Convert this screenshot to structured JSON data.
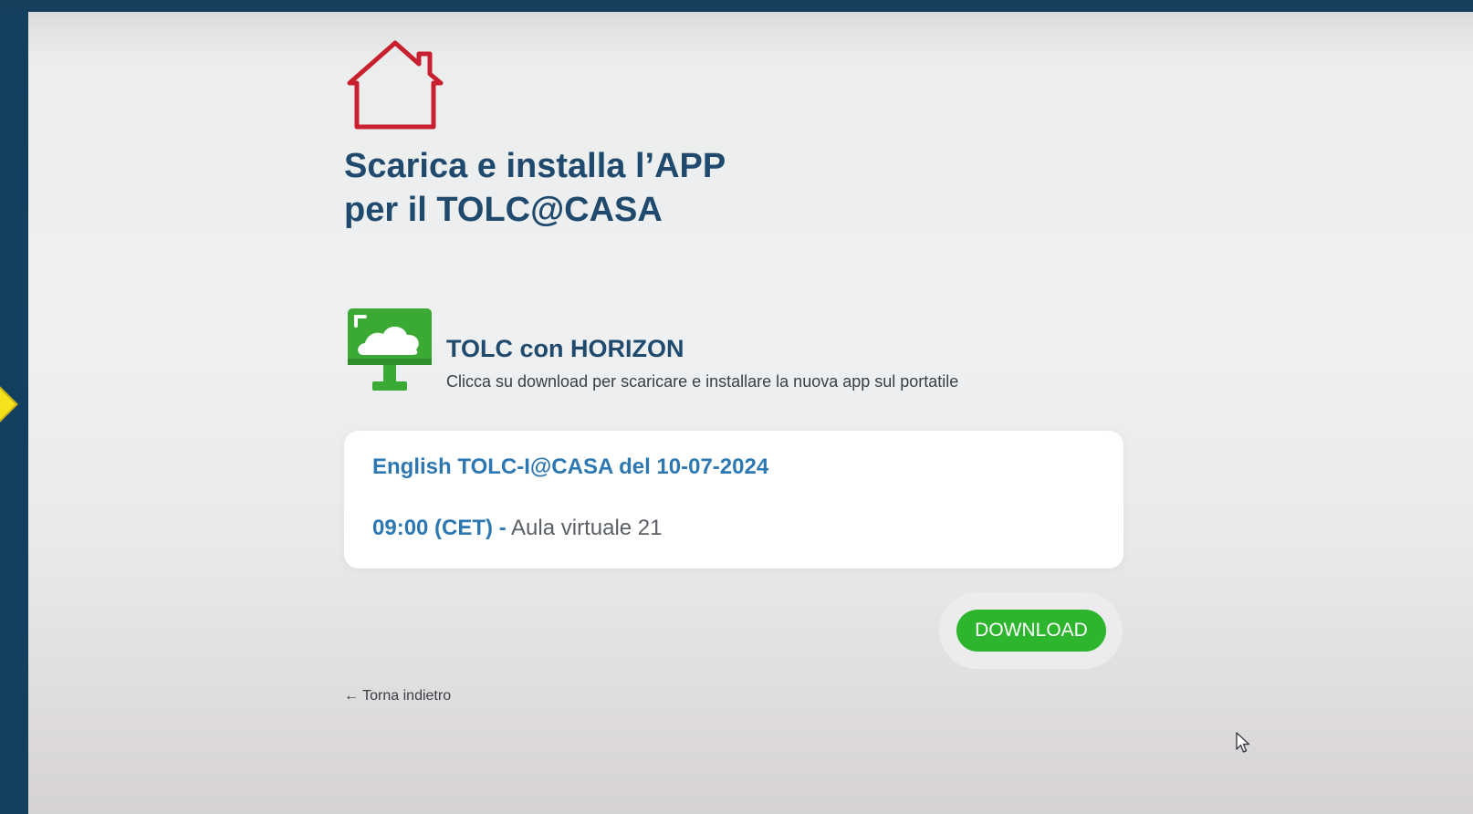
{
  "page": {
    "title_line1": "Scarica e installa l’APP",
    "title_line2": "per il TOLC@CASA"
  },
  "app": {
    "name": "TOLC con HORIZON",
    "description": "Clicca su download per scaricare e installare la nuova app sul portatile",
    "icon": "monitor-cloud-icon"
  },
  "session": {
    "title": "English TOLC-I@CASA del 10-07-2024",
    "time": "09:00 (CET) -",
    "room": "Aula virtuale 21"
  },
  "actions": {
    "download_label": "DOWNLOAD",
    "back_label": "Torna indietro",
    "back_arrow": "←"
  },
  "colors": {
    "heading": "#1f4a6e",
    "accent_blue": "#2d78b2",
    "download_green": "#2eb52e",
    "house_red": "#c8202f",
    "app_icon_green": "#3aaa35"
  }
}
